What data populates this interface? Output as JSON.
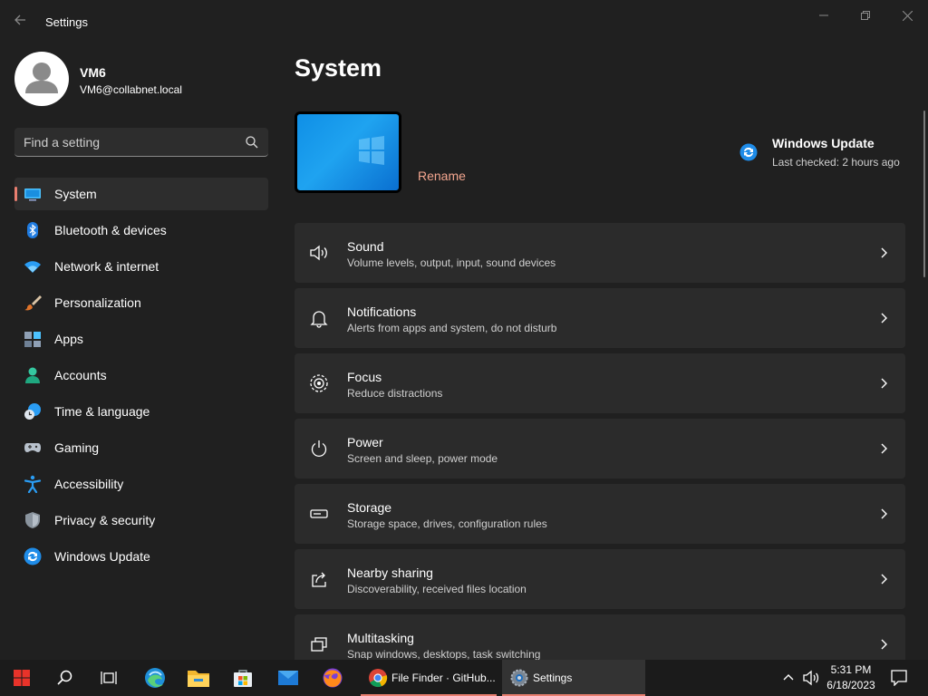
{
  "window": {
    "title": "Settings"
  },
  "user": {
    "name": "VM6",
    "email": "VM6@collabnet.local"
  },
  "search": {
    "placeholder": "Find a setting"
  },
  "nav": [
    {
      "label": "System",
      "icon": "monitor-icon",
      "active": true
    },
    {
      "label": "Bluetooth & devices",
      "icon": "bluetooth-icon"
    },
    {
      "label": "Network & internet",
      "icon": "wifi-icon"
    },
    {
      "label": "Personalization",
      "icon": "brush-icon"
    },
    {
      "label": "Apps",
      "icon": "apps-icon"
    },
    {
      "label": "Accounts",
      "icon": "person-icon"
    },
    {
      "label": "Time & language",
      "icon": "clock-globe-icon"
    },
    {
      "label": "Gaming",
      "icon": "gamepad-icon"
    },
    {
      "label": "Accessibility",
      "icon": "accessibility-icon"
    },
    {
      "label": "Privacy & security",
      "icon": "shield-icon"
    },
    {
      "label": "Windows Update",
      "icon": "sync-icon"
    }
  ],
  "main": {
    "title": "System",
    "rename_label": "Rename",
    "windows_update": {
      "title": "Windows Update",
      "subtitle": "Last checked: 2 hours ago"
    },
    "cards": [
      {
        "title": "Sound",
        "description": "Volume levels, output, input, sound devices",
        "icon": "speaker-icon"
      },
      {
        "title": "Notifications",
        "description": "Alerts from apps and system, do not disturb",
        "icon": "bell-icon"
      },
      {
        "title": "Focus",
        "description": "Reduce distractions",
        "icon": "focus-icon"
      },
      {
        "title": "Power",
        "description": "Screen and sleep, power mode",
        "icon": "power-icon"
      },
      {
        "title": "Storage",
        "description": "Storage space, drives, configuration rules",
        "icon": "storage-drive-icon"
      },
      {
        "title": "Nearby sharing",
        "description": "Discoverability, received files location",
        "icon": "share-icon"
      },
      {
        "title": "Multitasking",
        "description": "Snap windows, desktops, task switching",
        "icon": "multitasking-icon"
      }
    ]
  },
  "taskbar": {
    "apps": [
      {
        "label": "File Finder · GitHub...",
        "icon": "chrome-icon"
      },
      {
        "label": "Settings",
        "icon": "settings-gear-icon"
      }
    ],
    "clock": {
      "time": "5:31 PM",
      "date": "6/18/2023"
    }
  },
  "colors": {
    "accent": "#e87e6f",
    "link": "#f4a68f",
    "background": "#202020",
    "card": "#2b2b2b"
  }
}
